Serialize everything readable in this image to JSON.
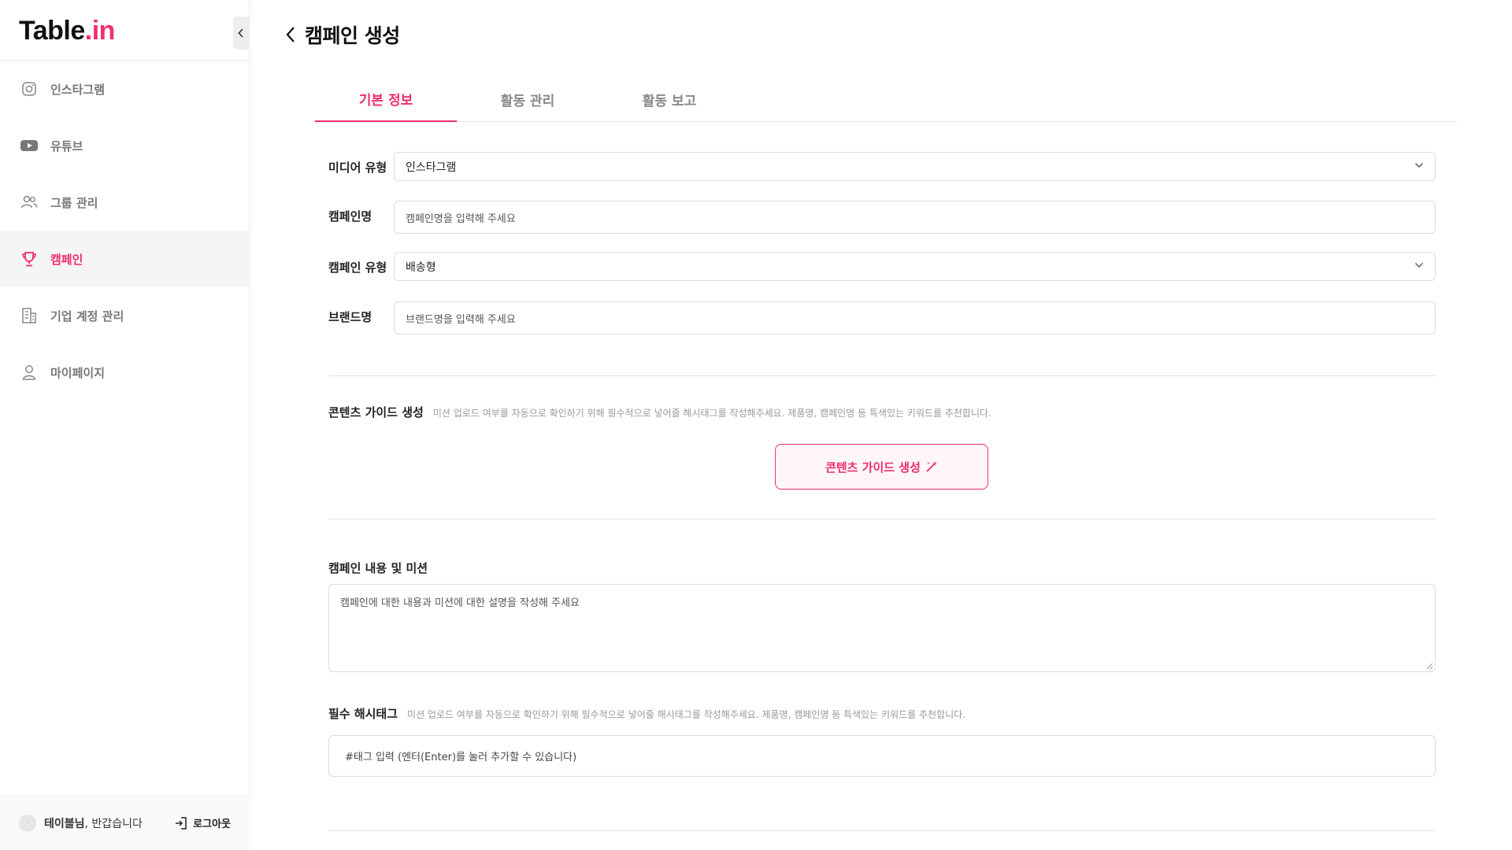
{
  "brand": {
    "logo_main": "Table",
    "logo_dot": ".in",
    "accent": "#ee2d6d"
  },
  "sidebar": {
    "items": [
      {
        "label": "인스타그램",
        "icon": "instagram-icon",
        "active": false
      },
      {
        "label": "유튜브",
        "icon": "youtube-icon",
        "active": false
      },
      {
        "label": "그룹 관리",
        "icon": "users-icon",
        "active": false
      },
      {
        "label": "캠페인",
        "icon": "trophy-icon",
        "active": true
      },
      {
        "label": "기업 계정 관리",
        "icon": "building-icon",
        "active": false
      },
      {
        "label": "마이페이지",
        "icon": "user-icon",
        "active": false
      }
    ],
    "footer": {
      "avatar_text": "·",
      "user_name": "테이블님",
      "greeting_suffix": ", 반갑습니다",
      "logout_label": "로그아웃"
    }
  },
  "header": {
    "title": "캠페인 생성"
  },
  "tabs": [
    {
      "label": "기본 정보",
      "active": true
    },
    {
      "label": "활동 관리",
      "active": false
    },
    {
      "label": "활동 보고",
      "active": false
    }
  ],
  "form": {
    "media_type": {
      "label": "미디어 유형",
      "value": "인스타그램"
    },
    "campaign_name": {
      "label": "캠페인명",
      "placeholder": "캠페인명을 입력해 주세요"
    },
    "campaign_type": {
      "label": "캠페인 유형",
      "value": "배송형"
    },
    "brand_name": {
      "label": "브랜드명",
      "placeholder": "브랜드명을 입력해 주세요"
    },
    "content_guide": {
      "title": "콘텐츠 가이드 생성",
      "description": "미션 업로드 여부를 자동으로 확인하기 위해 필수적으로 넣어줄 해시태그를 작성해주세요. 제품명, 캠페인명 등 특색있는 키워드를 추천합니다.",
      "button_label": "콘텐츠 가이드 생성"
    },
    "campaign_content": {
      "label": "캠페인 내용 및 미션",
      "placeholder": "캠페인에 대한 내용과 미션에 대한 설명을 작성해 주세요"
    },
    "hashtags": {
      "title": "필수 해시태그",
      "description": "미션 업로드 여부를 자동으로 확인하기 위해 필수적으로 넣어줄 해시태그를 작성해주세요. 제품명, 캠페인명 등 특색있는 키워드를 추천합니다.",
      "placeholder": "#태그 입력 (엔터(Enter)를 눌러 추가할 수 있습니다)"
    }
  }
}
